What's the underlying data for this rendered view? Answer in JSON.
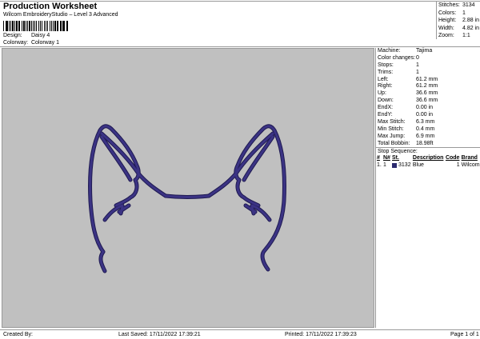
{
  "header": {
    "title": "Production Worksheet",
    "subtitle": "Wilcom EmbroideryStudio – Level 3 Advanced",
    "design_label": "Design:",
    "design_value": "Daisy 4",
    "colorway_label": "Colorway:",
    "colorway_value": "Colorway 1"
  },
  "stats": [
    {
      "label": "Stitches:",
      "value": "3134"
    },
    {
      "label": "Colors:",
      "value": "1"
    },
    {
      "label": "Height:",
      "value": "2.88 in"
    },
    {
      "label": "Width:",
      "value": "4.82 in"
    },
    {
      "label": "Zoom:",
      "value": "1:1"
    }
  ],
  "machine_info": [
    {
      "label": "Machine:",
      "value": "Tajima"
    },
    {
      "label": "Color changes:",
      "value": "0"
    },
    {
      "label": "Stops:",
      "value": "1"
    },
    {
      "label": "Trims:",
      "value": "1"
    },
    {
      "label": "Left:",
      "value": "61.2 mm"
    },
    {
      "label": "Right:",
      "value": "61.2 mm"
    },
    {
      "label": "Up:",
      "value": "36.6 mm"
    },
    {
      "label": "Down:",
      "value": "36.6 mm"
    },
    {
      "label": "EndX:",
      "value": "0.00 in"
    },
    {
      "label": "EndY:",
      "value": "0.00 in"
    },
    {
      "label": "Max Stitch:",
      "value": "6.3 mm"
    },
    {
      "label": "Min Stitch:",
      "value": "0.4 mm"
    },
    {
      "label": "Max Jump:",
      "value": "6.9 mm"
    },
    {
      "label": "Total Bobbin:",
      "value": "18.98ft"
    }
  ],
  "stop_sequence": {
    "title": "Stop Sequence:",
    "columns": [
      "#",
      "N#",
      "St.",
      "Description",
      "Code",
      "Brand"
    ],
    "rows": [
      {
        "num": "1.",
        "needle": "1",
        "stitches": "3132",
        "description": "Blue",
        "code": "1",
        "brand": "Wilcom",
        "color": "#2b2a6e"
      }
    ]
  },
  "design_color": "#3b3384",
  "footer": {
    "created_by": "Created By:",
    "last_saved": "Last Saved: 17/11/2022 17:39:21",
    "printed": "Printed: 17/11/2022 17:39:23",
    "page": "Page 1 of 1"
  }
}
